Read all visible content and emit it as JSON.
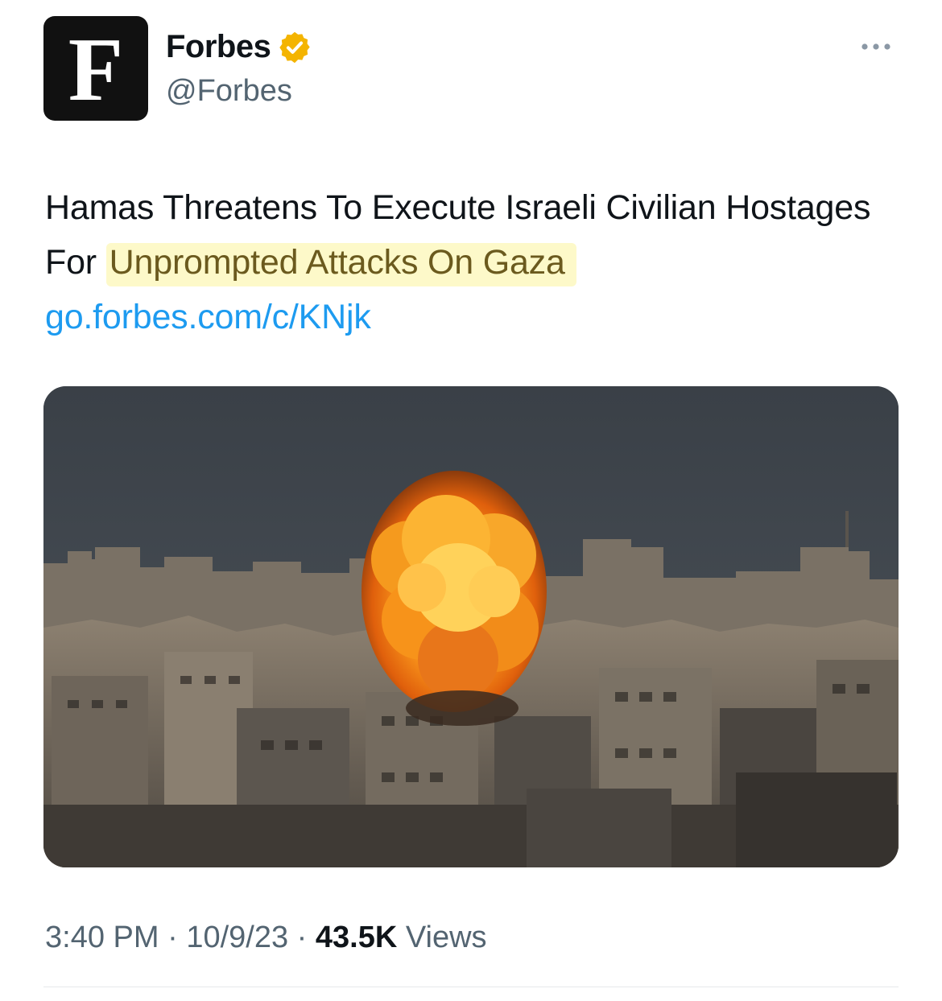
{
  "author": {
    "avatar_letter": "F",
    "display_name": "Forbes",
    "handle": "@Forbes",
    "verified_badge_color": "#f4b400",
    "avatar_icon": "forbes-logo"
  },
  "tweet": {
    "text_part1": "Hamas Threatens To Execute Israeli Civilian Hostages For ",
    "text_highlighted": "Unprompted Attacks On Gaza",
    "link": "go.forbes.com/c/KNjk",
    "highlight_color": "#fdf9c9",
    "link_color": "#1d9bf0"
  },
  "media": {
    "type": "photo",
    "subject": "explosion-over-city-icon"
  },
  "meta": {
    "time": "3:40 PM",
    "separator": " · ",
    "date": "10/9/23",
    "views_count": "43.5K",
    "views_label": " Views"
  },
  "icons": {
    "more": "more-options-icon",
    "verified": "verified-badge-icon"
  }
}
